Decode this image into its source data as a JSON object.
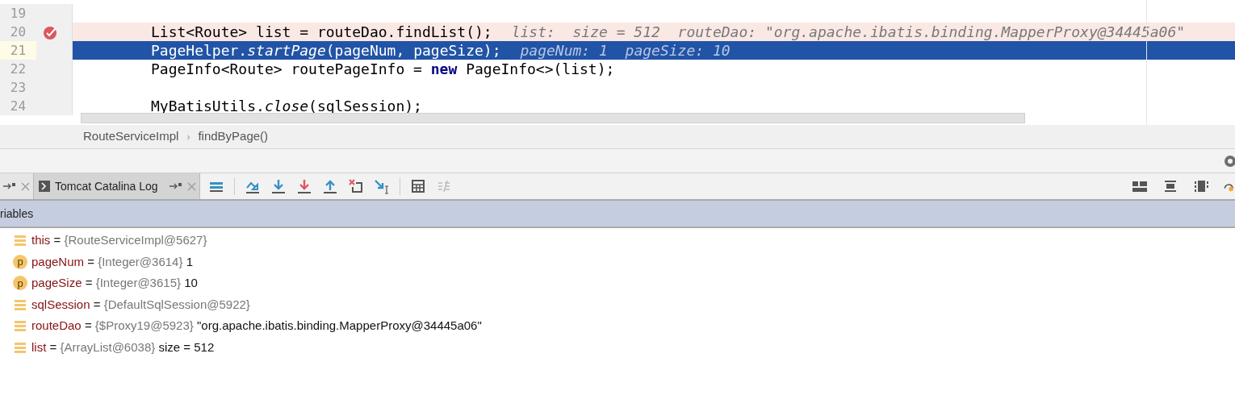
{
  "editor": {
    "lines": [
      {
        "number": "19",
        "breakpoint": false,
        "current": false
      },
      {
        "number": "20",
        "breakpoint": true,
        "current": false,
        "code": [
          {
            "text": "List<Route> list = routeDao.findList();",
            "kind": "text"
          }
        ],
        "hint": "list:  size = 512  routeDao: \"org.apache.ibatis.binding.MapperProxy@34445a06\""
      },
      {
        "number": "21",
        "breakpoint": false,
        "current": true,
        "code": [
          {
            "text": "PageHelper.",
            "kind": "text"
          },
          {
            "text": "startPage",
            "kind": "static"
          },
          {
            "text": "(pageNum, pageSize);",
            "kind": "text"
          }
        ],
        "hint": "pageNum: 1  pageSize: 10"
      },
      {
        "number": "22",
        "breakpoint": false,
        "current": false,
        "code": [
          {
            "text": "PageInfo<Route> routePageInfo = ",
            "kind": "text"
          },
          {
            "text": "new",
            "kind": "keyword"
          },
          {
            "text": " PageInfo<>(list);",
            "kind": "text"
          }
        ]
      },
      {
        "number": "23",
        "breakpoint": false,
        "current": false
      },
      {
        "number": "24",
        "breakpoint": false,
        "current": false,
        "code": [
          {
            "text": "MyBatisUtils.",
            "kind": "text"
          },
          {
            "text": "close",
            "kind": "static"
          },
          {
            "text": "(sqlSession);",
            "kind": "text"
          }
        ]
      }
    ]
  },
  "breadcrumbs": {
    "items": [
      "RouteServiceImpl",
      "findByPage()"
    ],
    "separator": "›"
  },
  "debug_tabs": [
    {
      "selected": false
    },
    {
      "label": "Tomcat Catalina Log",
      "selected": true
    }
  ],
  "variables": {
    "title": "riables",
    "items": [
      {
        "kind": "field",
        "name": "this",
        "equals": "=",
        "type": "{RouteServiceImpl@5627}"
      },
      {
        "kind": "parameter",
        "badge": "p",
        "name": "pageNum",
        "equals": "=",
        "type": "{Integer@3614}",
        "value": "1"
      },
      {
        "kind": "parameter",
        "badge": "p",
        "name": "pageSize",
        "equals": "=",
        "type": "{Integer@3615}",
        "value": "10"
      },
      {
        "kind": "field",
        "name": "sqlSession",
        "equals": "=",
        "type": "{DefaultSqlSession@5922}"
      },
      {
        "kind": "field",
        "name": "routeDao",
        "equals": "=",
        "type": "{$Proxy19@5923}",
        "value": "\"org.apache.ibatis.binding.MapperProxy@34445a06\""
      },
      {
        "kind": "field",
        "name": "list",
        "equals": "=",
        "type": "{ArrayList@6038}",
        "value": "size = 512"
      }
    ]
  }
}
